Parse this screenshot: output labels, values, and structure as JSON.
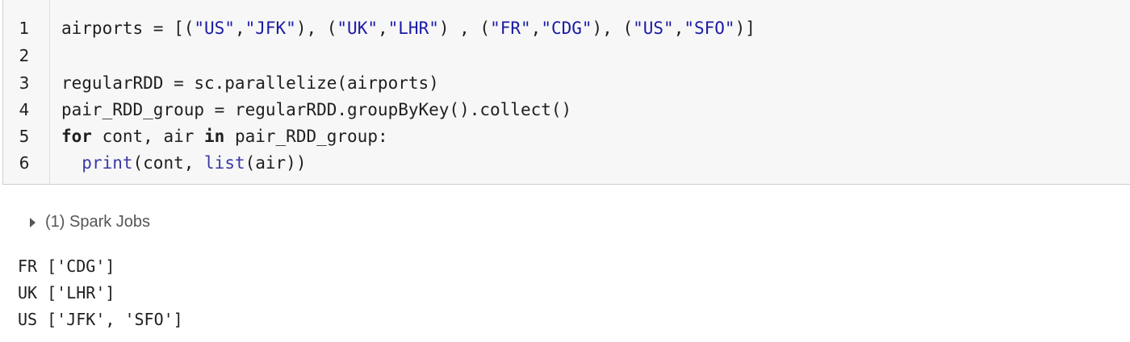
{
  "cell": {
    "line_numbers": [
      "1",
      "2",
      "3",
      "4",
      "5",
      "6"
    ]
  },
  "code": {
    "l1": {
      "a": "airports = [(",
      "s1": "\"US\"",
      "c1": ",",
      "s2": "\"JFK\"",
      "c2": "), (",
      "s3": "\"UK\"",
      "c3": ",",
      "s4": "\"LHR\"",
      "c4": ") , (",
      "s5": "\"FR\"",
      "c5": ",",
      "s6": "\"CDG\"",
      "c6": "), (",
      "s7": "\"US\"",
      "c7": ",",
      "s8": "\"SFO\"",
      "c8": ")]"
    },
    "l3": "regularRDD = sc.parallelize(airports)",
    "l4": "pair_RDD_group = regularRDD.groupByKey().collect()",
    "l5": {
      "kw_for": "for",
      "mid": " cont, air ",
      "kw_in": "in",
      "rest": " pair_RDD_group:"
    },
    "l6": {
      "indent": "  ",
      "fn_print": "print",
      "p1": "(cont, ",
      "fn_list": "list",
      "p2": "(air))"
    }
  },
  "spark_jobs": {
    "label": "(1) Spark Jobs"
  },
  "output": {
    "lines": [
      "FR ['CDG']",
      "UK ['LHR']",
      "US ['JFK', 'SFO']"
    ]
  },
  "colors": {
    "string": "#1a1aa6",
    "cell_bg": "#f7f7f7"
  }
}
